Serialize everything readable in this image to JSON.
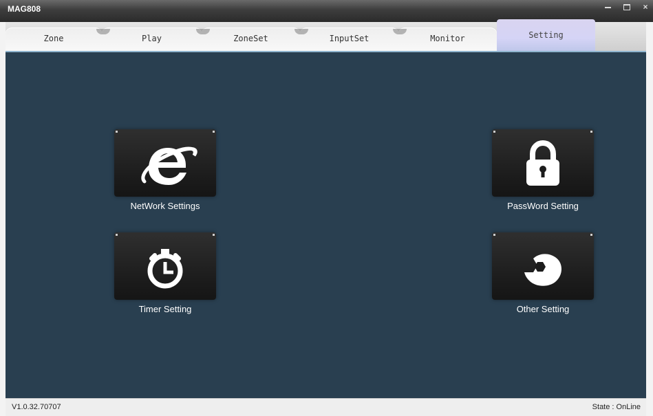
{
  "window": {
    "title": "MAG808",
    "controls": {
      "minimize": "minimize-icon",
      "maximize": "maximize-icon",
      "close": "×"
    }
  },
  "tabs": [
    {
      "label": "Zone",
      "active": false
    },
    {
      "label": "Play",
      "active": false
    },
    {
      "label": "ZoneSet",
      "active": false
    },
    {
      "label": "InputSet",
      "active": false
    },
    {
      "label": "Monitor",
      "active": false
    },
    {
      "label": "Setting",
      "active": true
    }
  ],
  "settings": {
    "network": {
      "label": "NetWork Settings",
      "icon": "internet-explorer-icon"
    },
    "password": {
      "label": "PassWord Setting",
      "icon": "lock-icon"
    },
    "timer": {
      "label": "Timer Setting",
      "icon": "stopwatch-icon"
    },
    "other": {
      "label": "Other Setting",
      "icon": "wrench-icon"
    }
  },
  "status": {
    "version": "V1.0.32.70707",
    "state": "State : OnLine"
  },
  "colors": {
    "content_bg": "#293f50",
    "active_tab": "#d5d4f6",
    "titlebar": "#2b2b2b"
  }
}
